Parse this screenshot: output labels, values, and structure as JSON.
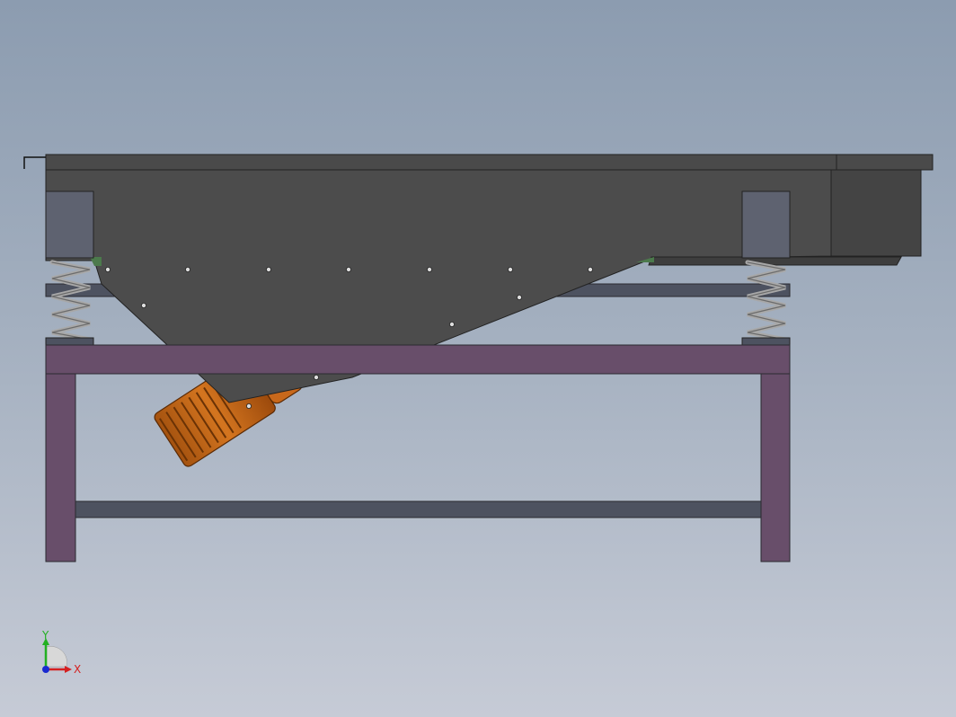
{
  "triad": {
    "x_label": "X",
    "y_label": "Y",
    "x_color": "#d42020",
    "y_color": "#22b022",
    "z_color": "#1a2ad0"
  },
  "model": {
    "trough_color": "#4c4c4c",
    "frame_color": "#684e6a",
    "rail_color": "#4d5260",
    "motor_color": "#c86a1c",
    "spring_color": "#a8a8a8",
    "mount_color": "#5e6270"
  }
}
